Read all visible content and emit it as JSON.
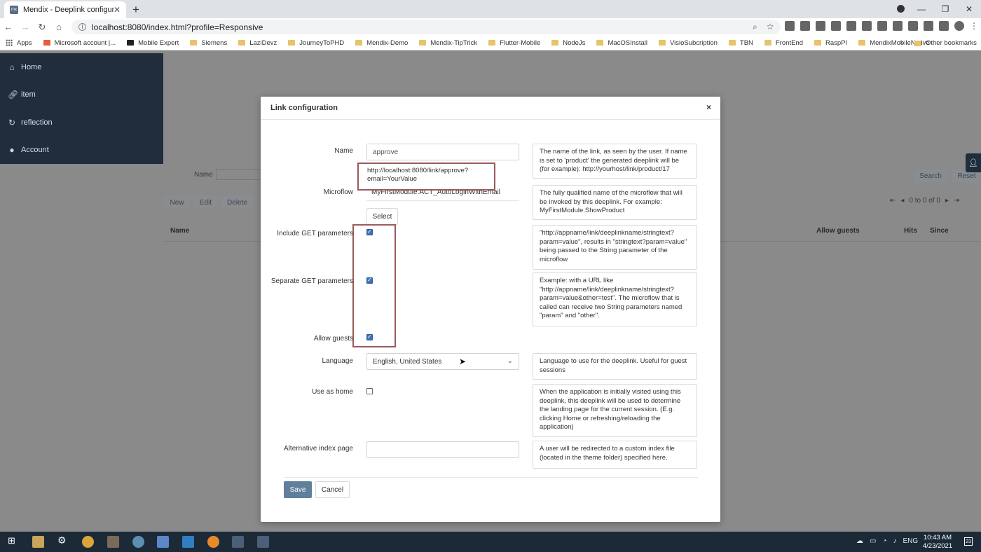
{
  "browser": {
    "tab_title": "Mendix - Deeplink configuration",
    "tab_favicon_text": "mx",
    "url": "localhost:8080/index.html?profile=Responsive",
    "bookmarks": [
      "Apps",
      "Microsoft account |...",
      "Mobile Expert",
      "Siemens",
      "LaziDevz",
      "JourneyToPHD",
      "Mendix-Demo",
      "Mendix-TipTrick",
      "Flutter-Mobile",
      "NodeJs",
      "MacOSInstall",
      "VisioSubcription",
      "TBN",
      "FrontEnd",
      "RaspPI",
      "MendixMobileNative"
    ],
    "other_bookmarks": "Other bookmarks",
    "more_bookmarks": "»"
  },
  "sidebar": {
    "items": [
      {
        "label": "Home",
        "icon": "home-icon"
      },
      {
        "label": "item",
        "icon": "link-icon"
      },
      {
        "label": "reflection",
        "icon": "refresh-icon"
      },
      {
        "label": "Account",
        "icon": "user-icon"
      }
    ]
  },
  "background": {
    "name_label": "Name",
    "search": "Search",
    "reset": "Reset",
    "new": "New",
    "edit": "Edit",
    "delete": "Delete",
    "pager_text": "0 to 0 of 0",
    "columns": {
      "name": "Name",
      "allow_guests": "Allow guests",
      "hits": "Hits",
      "since": "Since"
    }
  },
  "modal": {
    "title": "Link configuration",
    "close": "×",
    "fields": {
      "name": {
        "label": "Name",
        "value": "approve",
        "help": "The name of the link, as seen by the user. If name is set to 'product' the generated deeplink will be (for example): http://yourhost/link/product/17"
      },
      "microflow": {
        "label": "Microflow",
        "value": "MyFirstModule.ACT_AutoLoginWithEmail",
        "select": "Select",
        "help": "The fully qualified name of the microflow that will be invoked by this deeplink. For example: MyFirstModule.ShowProduct"
      },
      "include_get": {
        "label": "Include GET parameters",
        "checked": true,
        "help": "\"http://appname/link/deeplinkname/stringtext?param=value\", results in \"stringtext?param=value\" being passed to the String parameter of the microflow"
      },
      "separate_get": {
        "label": "Separate GET parameters",
        "checked": true,
        "help": "Example: with a URL like \"http://appname/link/deeplinkname/stringtext?param=value&other=test\". The microflow that is called can receive two String parameters named \"param\" and \"other\"."
      },
      "allow_guests": {
        "label": "Allow guests",
        "checked": true
      },
      "language": {
        "label": "Language",
        "value": "English, United States",
        "help": "Language to use for the deeplink. Useful for guest sessions"
      },
      "use_as_home": {
        "label": "Use as home",
        "checked": false,
        "help": "When the application is initially visited using this deeplink, this deeplink will be used to determine the landing page for the current session. (E.g. clicking Home or refreshing/reloading the application)"
      },
      "alt_index": {
        "label": "Alternative index page",
        "value": "",
        "help": "A user will be redirected to a custom index file (located in the theme folder) specified here."
      }
    },
    "url_callout": "http://localhost:8080/link/approve?email=YourValue",
    "save": "Save",
    "cancel": "Cancel"
  },
  "taskbar": {
    "language": "ENG",
    "time": "10:43 AM",
    "date": "4/23/2021",
    "notifications": "23"
  },
  "colors": {
    "sidebar_bg": "#1f2d3d",
    "overlay": "#8a8a8a",
    "primary_button": "#5f7f9b",
    "annotation_border": "#9a5b5b",
    "checkbox_checked": "#3b73b5"
  }
}
